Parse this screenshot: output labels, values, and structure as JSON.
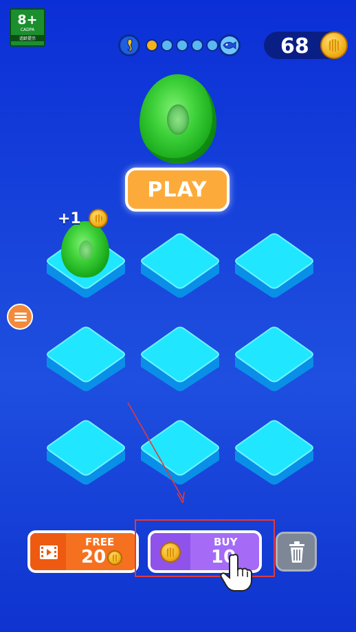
{
  "age_rating": {
    "label": "8+",
    "org": "CADPA",
    "sub": "适龄提示"
  },
  "progress": {
    "start_icon": "seahorse-icon",
    "end_icon": "fish-icon",
    "dot_colors": [
      "#f5b318",
      "#5ab8f2",
      "#5ab8f2",
      "#5ab8f2",
      "#5ab8f2"
    ]
  },
  "coins": {
    "value": "68",
    "icon": "shell-coin-icon"
  },
  "play_button": {
    "label": "PLAY"
  },
  "reward_popup": {
    "text": "+1"
  },
  "grid": {
    "rows": 3,
    "cols": 3,
    "occupied_slot": 0
  },
  "buttons": {
    "free": {
      "title": "FREE",
      "amount": "20",
      "icon": "video-icon"
    },
    "buy": {
      "title": "BUY",
      "amount": "10",
      "icon": "shell-coin-icon"
    },
    "trash": {
      "icon": "trash-icon"
    }
  },
  "colors": {
    "background": "#1a48dc",
    "tile": "#1ee3ff",
    "play": "#fcab3a",
    "free": "#f57120",
    "buy": "#a56bf6",
    "highlight": "#e23a3a"
  }
}
